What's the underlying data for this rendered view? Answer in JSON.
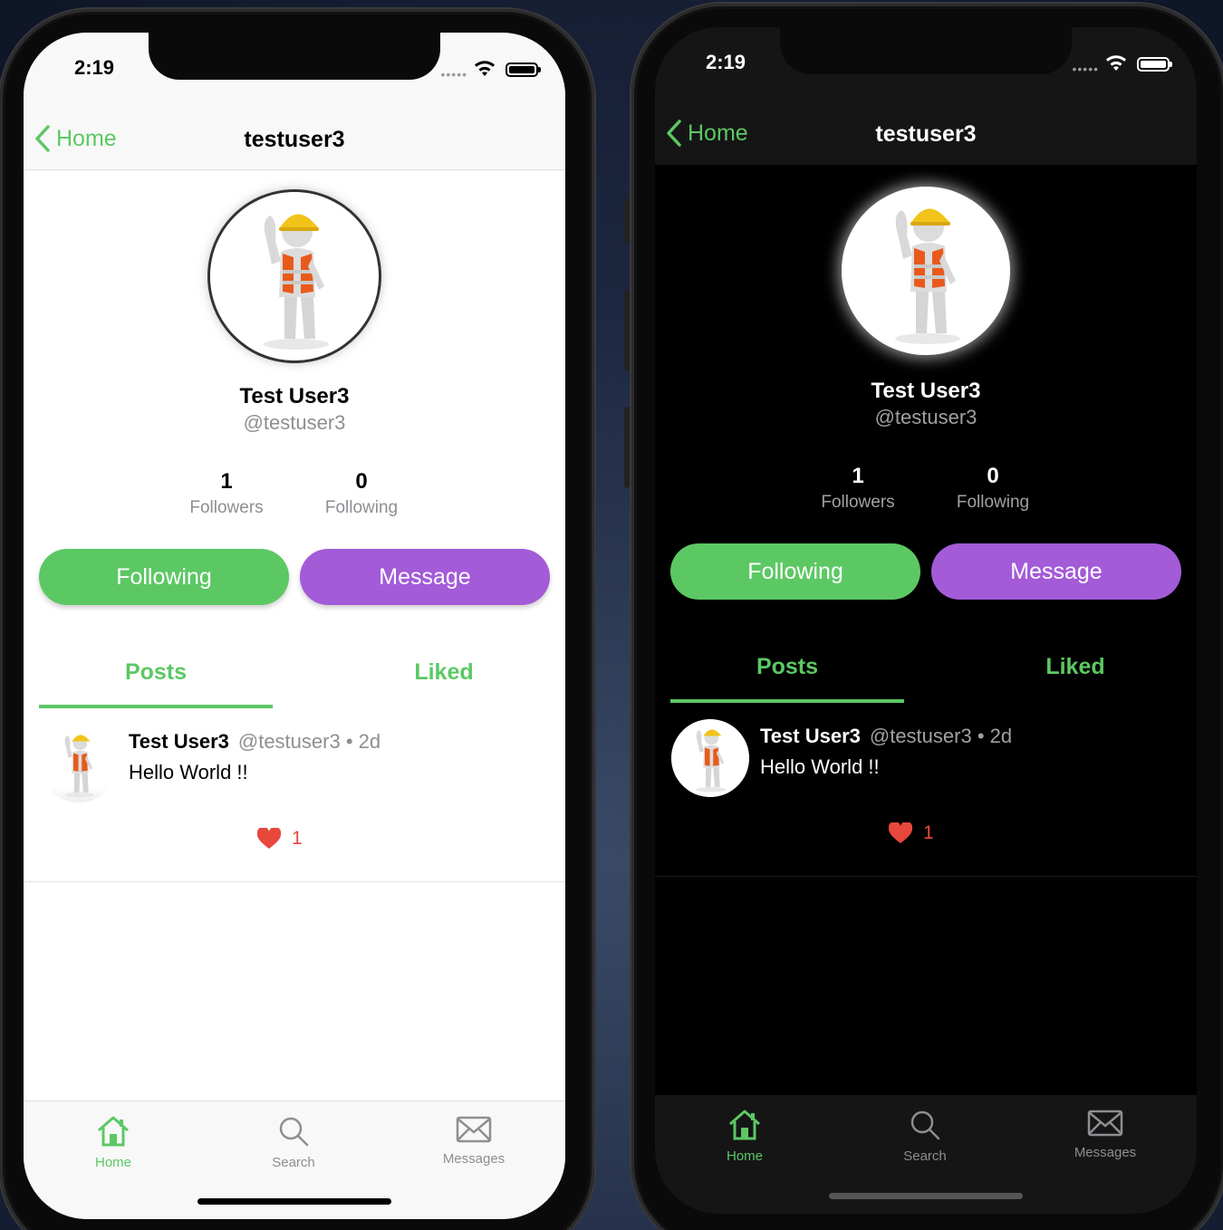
{
  "status_bar": {
    "time": "2:19"
  },
  "nav": {
    "back_label": "Home",
    "title": "testuser3"
  },
  "profile": {
    "display_name": "Test User3",
    "username": "@testuser3",
    "followers_count": "1",
    "followers_label": "Followers",
    "following_count": "0",
    "following_label": "Following"
  },
  "actions": {
    "follow_label": "Following",
    "message_label": "Message"
  },
  "tabs": {
    "posts_label": "Posts",
    "liked_label": "Liked",
    "active": "Posts"
  },
  "post": {
    "author_name": "Test User3",
    "author_meta": "@testuser3 •  2d",
    "text": "Hello World !!",
    "like_count": "1"
  },
  "tab_bar": {
    "items": [
      {
        "label": "Home",
        "icon": "home-icon",
        "active": true
      },
      {
        "label": "Search",
        "icon": "search-icon",
        "active": false
      },
      {
        "label": "Messages",
        "icon": "envelope-icon",
        "active": false
      }
    ]
  },
  "colors": {
    "accent_green": "#5cc864",
    "message_purple": "#a35bd8",
    "like_red": "#e8473c",
    "muted_gray": "#8e8e93"
  },
  "themes": [
    "light",
    "dark"
  ]
}
